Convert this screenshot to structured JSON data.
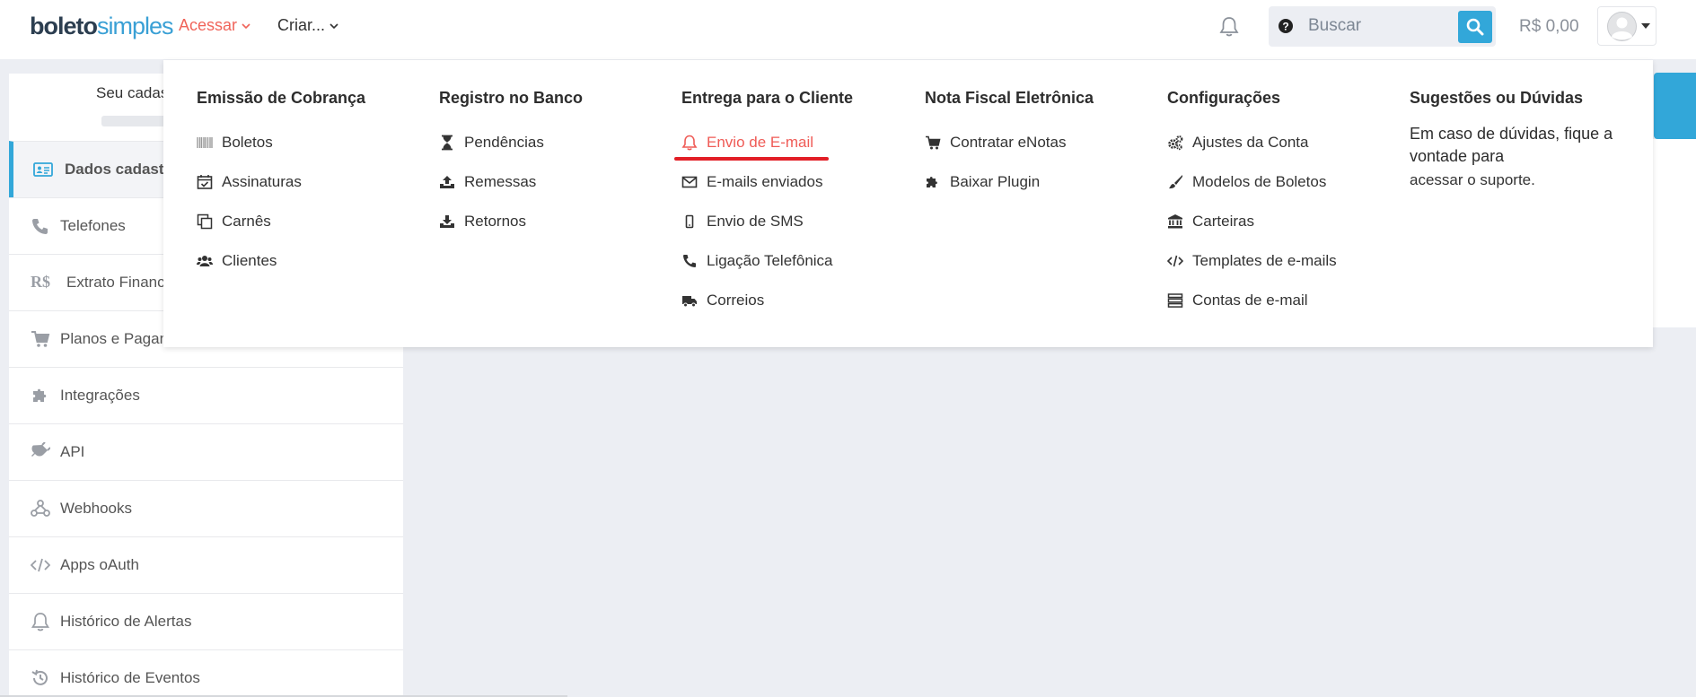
{
  "brand": {
    "logo_bold": "boleto",
    "logo_light": "simples"
  },
  "topnav": {
    "acessar": "Acessar",
    "criar": "Criar..."
  },
  "search": {
    "placeholder": "Buscar"
  },
  "balance": "R$ 0,00",
  "profile": {
    "text": "Seu cadas"
  },
  "sidebar": {
    "items": [
      {
        "label": "Dados cadast",
        "icon": "id-card-icon",
        "active": true
      },
      {
        "label": "Telefones",
        "icon": "phone-icon"
      },
      {
        "label": "Extrato Financ",
        "icon": "currency-icon",
        "icon_text": "R$"
      },
      {
        "label": "Planos e Pagan",
        "icon": "cart-icon"
      },
      {
        "label": "Integrações",
        "icon": "puzzle-icon"
      },
      {
        "label": "API",
        "icon": "plug-icon"
      },
      {
        "label": "Webhooks",
        "icon": "webhook-icon"
      },
      {
        "label": "Apps oAuth",
        "icon": "code-icon"
      },
      {
        "label": "Histórico de Alertas",
        "icon": "bell-icon"
      },
      {
        "label": "Histórico de Eventos",
        "icon": "history-icon"
      }
    ]
  },
  "menu": {
    "columns": [
      {
        "title": "Emissão de Cobrança",
        "items": [
          {
            "label": "Boletos",
            "icon": "barcode-icon"
          },
          {
            "label": "Assinaturas",
            "icon": "calendar-check-icon"
          },
          {
            "label": "Carnês",
            "icon": "copy-icon"
          },
          {
            "label": "Clientes",
            "icon": "users-icon"
          }
        ]
      },
      {
        "title": "Registro no Banco",
        "items": [
          {
            "label": "Pendências",
            "icon": "hourglass-icon"
          },
          {
            "label": "Remessas",
            "icon": "upload-icon"
          },
          {
            "label": "Retornos",
            "icon": "download-icon"
          }
        ]
      },
      {
        "title": "Entrega para o Cliente",
        "items": [
          {
            "label": "Envio de E-mail",
            "icon": "bell-icon",
            "highlight": true
          },
          {
            "label": "E-mails enviados",
            "icon": "envelope-icon"
          },
          {
            "label": "Envio de SMS",
            "icon": "mobile-icon"
          },
          {
            "label": "Ligação Telefônica",
            "icon": "phone-icon"
          },
          {
            "label": "Correios",
            "icon": "truck-icon"
          }
        ]
      },
      {
        "title": "Nota Fiscal Eletrônica",
        "items": [
          {
            "label": "Contratar eNotas",
            "icon": "cart-icon"
          },
          {
            "label": "Baixar Plugin",
            "icon": "puzzle-icon"
          }
        ]
      },
      {
        "title": "Configurações",
        "items": [
          {
            "label": "Ajustes da Conta",
            "icon": "gears-icon"
          },
          {
            "label": "Modelos de Boletos",
            "icon": "brush-icon"
          },
          {
            "label": "Carteiras",
            "icon": "bank-icon"
          },
          {
            "label": "Templates de e-mails",
            "icon": "code-icon"
          },
          {
            "label": "Contas de e-mail",
            "icon": "server-icon"
          }
        ]
      },
      {
        "title": "Sugestões ou Dúvidas",
        "help_text": "Em caso de dúvidas, fique a vontade para",
        "help_link": "acessar o suporte",
        "help_suffix": "."
      }
    ]
  },
  "colors": {
    "accent_blue": "#32a7d9",
    "highlight_red": "#ef5b56",
    "underline_red": "#e21e26"
  }
}
